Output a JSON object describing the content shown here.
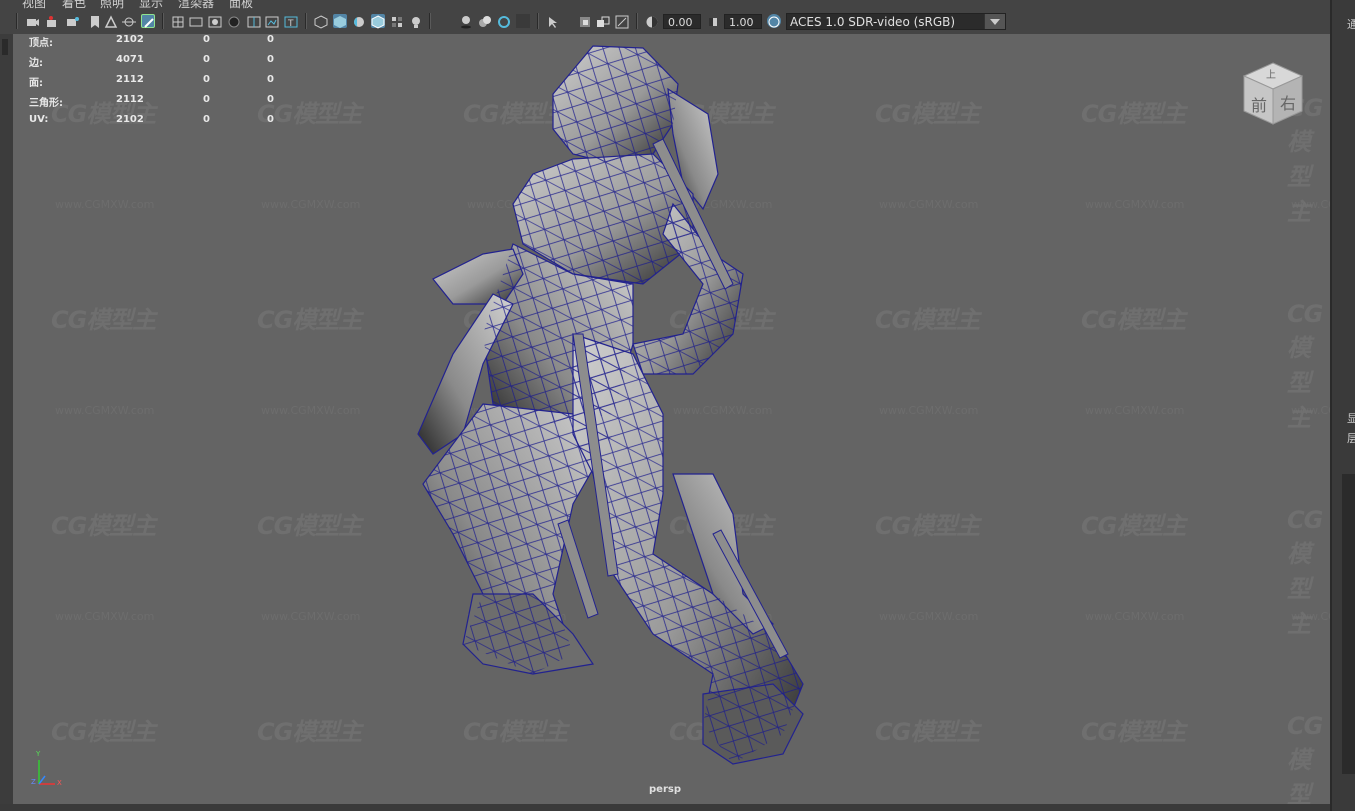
{
  "menu": [
    "视图",
    "着色",
    "照明",
    "显示",
    "渲染器",
    "面板"
  ],
  "toolbar": {
    "exposure_value": "0.00",
    "gamma_value": "1.00",
    "color_space": "ACES 1.0 SDR-video (sRGB)"
  },
  "hud": {
    "rows": [
      {
        "label": "顶点:",
        "v1": "2102",
        "v2": "0",
        "v3": "0"
      },
      {
        "label": "边:",
        "v1": "4071",
        "v2": "0",
        "v3": "0"
      },
      {
        "label": "面:",
        "v1": "2112",
        "v2": "0",
        "v3": "0"
      },
      {
        "label": "三角形:",
        "v1": "2112",
        "v2": "0",
        "v3": "0"
      },
      {
        "label": "UV:",
        "v1": "2102",
        "v2": "0",
        "v3": "0"
      }
    ]
  },
  "viewcube": {
    "front": "前",
    "right": "右",
    "top": "上"
  },
  "camera_label": "persp",
  "watermark": {
    "logo": "CG模型主",
    "url": "www.CGMXW.com"
  },
  "right_panel_chars": [
    "通",
    "显",
    "层"
  ],
  "axis_labels": {
    "y": "Y",
    "z": "Z",
    "x": "X"
  }
}
